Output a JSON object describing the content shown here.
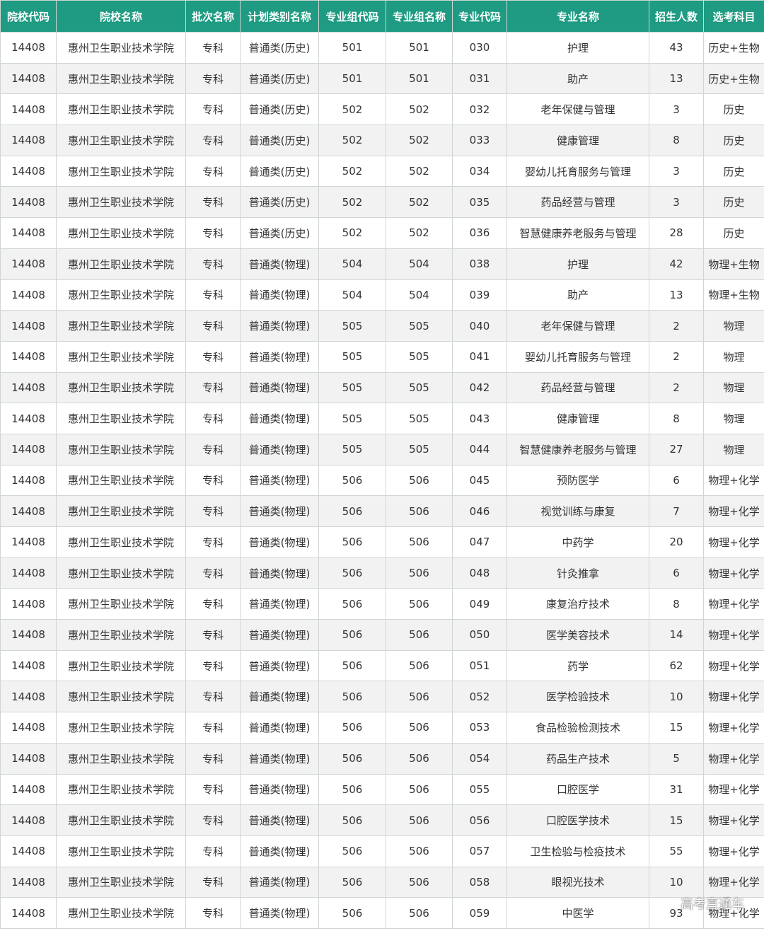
{
  "colors": {
    "header_bg": "#1e9b82",
    "header_text": "#ffffff",
    "stripe": "#f2f2f2"
  },
  "table": {
    "headers": [
      "院校代码",
      "院校名称",
      "批次名称",
      "计划类别名称",
      "专业组代码",
      "专业组名称",
      "专业代码",
      "专业名称",
      "招生人数",
      "选考科目"
    ],
    "rows": [
      [
        "14408",
        "惠州卫生职业技术学院",
        "专科",
        "普通类(历史)",
        "501",
        "501",
        "030",
        "护理",
        "43",
        "历史+生物"
      ],
      [
        "14408",
        "惠州卫生职业技术学院",
        "专科",
        "普通类(历史)",
        "501",
        "501",
        "031",
        "助产",
        "13",
        "历史+生物"
      ],
      [
        "14408",
        "惠州卫生职业技术学院",
        "专科",
        "普通类(历史)",
        "502",
        "502",
        "032",
        "老年保健与管理",
        "3",
        "历史"
      ],
      [
        "14408",
        "惠州卫生职业技术学院",
        "专科",
        "普通类(历史)",
        "502",
        "502",
        "033",
        "健康管理",
        "8",
        "历史"
      ],
      [
        "14408",
        "惠州卫生职业技术学院",
        "专科",
        "普通类(历史)",
        "502",
        "502",
        "034",
        "婴幼儿托育服务与管理",
        "3",
        "历史"
      ],
      [
        "14408",
        "惠州卫生职业技术学院",
        "专科",
        "普通类(历史)",
        "502",
        "502",
        "035",
        "药品经营与管理",
        "3",
        "历史"
      ],
      [
        "14408",
        "惠州卫生职业技术学院",
        "专科",
        "普通类(历史)",
        "502",
        "502",
        "036",
        "智慧健康养老服务与管理",
        "28",
        "历史"
      ],
      [
        "14408",
        "惠州卫生职业技术学院",
        "专科",
        "普通类(物理)",
        "504",
        "504",
        "038",
        "护理",
        "42",
        "物理+生物"
      ],
      [
        "14408",
        "惠州卫生职业技术学院",
        "专科",
        "普通类(物理)",
        "504",
        "504",
        "039",
        "助产",
        "13",
        "物理+生物"
      ],
      [
        "14408",
        "惠州卫生职业技术学院",
        "专科",
        "普通类(物理)",
        "505",
        "505",
        "040",
        "老年保健与管理",
        "2",
        "物理"
      ],
      [
        "14408",
        "惠州卫生职业技术学院",
        "专科",
        "普通类(物理)",
        "505",
        "505",
        "041",
        "婴幼儿托育服务与管理",
        "2",
        "物理"
      ],
      [
        "14408",
        "惠州卫生职业技术学院",
        "专科",
        "普通类(物理)",
        "505",
        "505",
        "042",
        "药品经营与管理",
        "2",
        "物理"
      ],
      [
        "14408",
        "惠州卫生职业技术学院",
        "专科",
        "普通类(物理)",
        "505",
        "505",
        "043",
        "健康管理",
        "8",
        "物理"
      ],
      [
        "14408",
        "惠州卫生职业技术学院",
        "专科",
        "普通类(物理)",
        "505",
        "505",
        "044",
        "智慧健康养老服务与管理",
        "27",
        "物理"
      ],
      [
        "14408",
        "惠州卫生职业技术学院",
        "专科",
        "普通类(物理)",
        "506",
        "506",
        "045",
        "预防医学",
        "6",
        "物理+化学"
      ],
      [
        "14408",
        "惠州卫生职业技术学院",
        "专科",
        "普通类(物理)",
        "506",
        "506",
        "046",
        "视觉训练与康复",
        "7",
        "物理+化学"
      ],
      [
        "14408",
        "惠州卫生职业技术学院",
        "专科",
        "普通类(物理)",
        "506",
        "506",
        "047",
        "中药学",
        "20",
        "物理+化学"
      ],
      [
        "14408",
        "惠州卫生职业技术学院",
        "专科",
        "普通类(物理)",
        "506",
        "506",
        "048",
        "针灸推拿",
        "6",
        "物理+化学"
      ],
      [
        "14408",
        "惠州卫生职业技术学院",
        "专科",
        "普通类(物理)",
        "506",
        "506",
        "049",
        "康复治疗技术",
        "8",
        "物理+化学"
      ],
      [
        "14408",
        "惠州卫生职业技术学院",
        "专科",
        "普通类(物理)",
        "506",
        "506",
        "050",
        "医学美容技术",
        "14",
        "物理+化学"
      ],
      [
        "14408",
        "惠州卫生职业技术学院",
        "专科",
        "普通类(物理)",
        "506",
        "506",
        "051",
        "药学",
        "62",
        "物理+化学"
      ],
      [
        "14408",
        "惠州卫生职业技术学院",
        "专科",
        "普通类(物理)",
        "506",
        "506",
        "052",
        "医学检验技术",
        "10",
        "物理+化学"
      ],
      [
        "14408",
        "惠州卫生职业技术学院",
        "专科",
        "普通类(物理)",
        "506",
        "506",
        "053",
        "食品检验检测技术",
        "15",
        "物理+化学"
      ],
      [
        "14408",
        "惠州卫生职业技术学院",
        "专科",
        "普通类(物理)",
        "506",
        "506",
        "054",
        "药品生产技术",
        "5",
        "物理+化学"
      ],
      [
        "14408",
        "惠州卫生职业技术学院",
        "专科",
        "普通类(物理)",
        "506",
        "506",
        "055",
        "口腔医学",
        "31",
        "物理+化学"
      ],
      [
        "14408",
        "惠州卫生职业技术学院",
        "专科",
        "普通类(物理)",
        "506",
        "506",
        "056",
        "口腔医学技术",
        "15",
        "物理+化学"
      ],
      [
        "14408",
        "惠州卫生职业技术学院",
        "专科",
        "普通类(物理)",
        "506",
        "506",
        "057",
        "卫生检验与检疫技术",
        "55",
        "物理+化学"
      ],
      [
        "14408",
        "惠州卫生职业技术学院",
        "专科",
        "普通类(物理)",
        "506",
        "506",
        "058",
        "眼视光技术",
        "10",
        "物理+化学"
      ],
      [
        "14408",
        "惠州卫生职业技术学院",
        "专科",
        "普通类(物理)",
        "506",
        "506",
        "059",
        "中医学",
        "93",
        "物理+化学"
      ]
    ]
  },
  "watermark": "高考直通车"
}
